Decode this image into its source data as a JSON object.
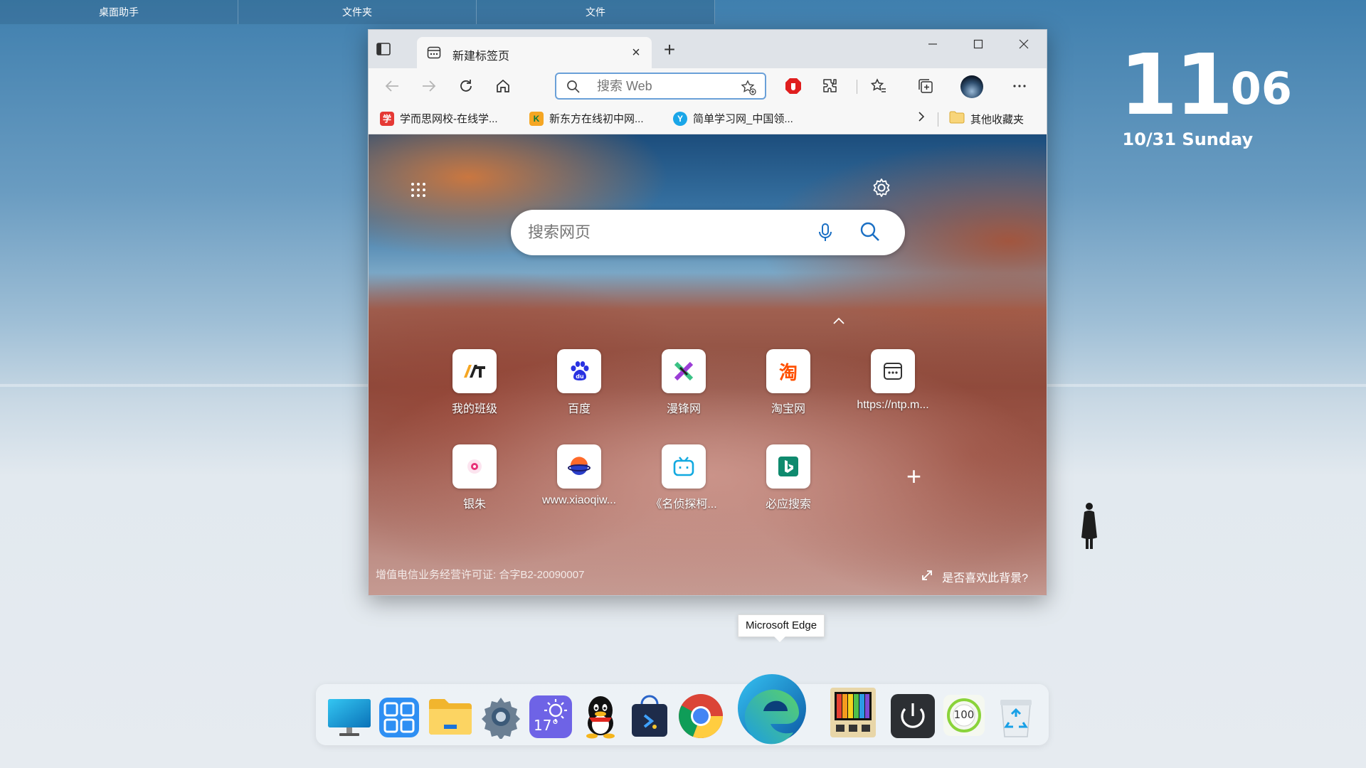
{
  "desktop_tabs": [
    "桌面助手",
    "文件夹",
    "文件"
  ],
  "clock": {
    "hours": "11",
    "minutes": "06",
    "date": "10/31 Sunday"
  },
  "browser": {
    "tab": {
      "title": "新建标签页"
    },
    "address": {
      "placeholder": "搜索 Web"
    },
    "bookmarks": [
      {
        "label": "学而思网校-在线学...",
        "color": "#e53935",
        "icon_text": "学"
      },
      {
        "label": "新东方在线初中网...",
        "color": "#f5a623",
        "icon_text": "K"
      },
      {
        "label": "简单学习网_中国领...",
        "color": "#1aa6e8",
        "icon_text": "Y"
      }
    ],
    "other_bookmarks": "其他收藏夹"
  },
  "ntp": {
    "search_placeholder": "搜索网页",
    "tiles": [
      {
        "label": "我的班级"
      },
      {
        "label": "百度"
      },
      {
        "label": "漫锋网"
      },
      {
        "label": "淘宝网"
      },
      {
        "label": "https://ntp.m..."
      },
      {
        "label": "银朱"
      },
      {
        "label": "www.xiaoqiw..."
      },
      {
        "label": "《名侦探柯..."
      },
      {
        "label": "必应搜索"
      }
    ],
    "license": "增值电信业务经营许可证: 合字B2-20090007",
    "like_background": "是否喜欢此背景?"
  },
  "tooltip": "Microsoft Edge",
  "dock": {
    "weather_temp": "17°",
    "score": "100"
  }
}
